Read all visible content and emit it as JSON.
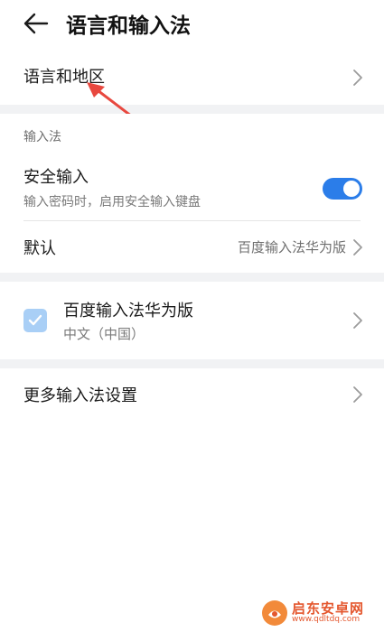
{
  "header": {
    "title": "语言和输入法"
  },
  "language_region": {
    "label": "语言和地区"
  },
  "input_section": {
    "header": "输入法",
    "secure_input": {
      "title": "安全输入",
      "subtitle": "输入密码时，启用安全输入键盘",
      "enabled": true
    },
    "default": {
      "label": "默认",
      "value": "百度输入法华为版"
    }
  },
  "keyboards": [
    {
      "name": "百度输入法华为版",
      "language": "中文（中国）",
      "checked": true
    }
  ],
  "more_settings": {
    "label": "更多输入法设置"
  },
  "watermark": {
    "cn": "启东安卓网",
    "en": "www.qdltdq.com"
  },
  "colors": {
    "accent": "#2b7de9",
    "checkbox": "#a9cff6",
    "annotation": "#e8483f"
  }
}
